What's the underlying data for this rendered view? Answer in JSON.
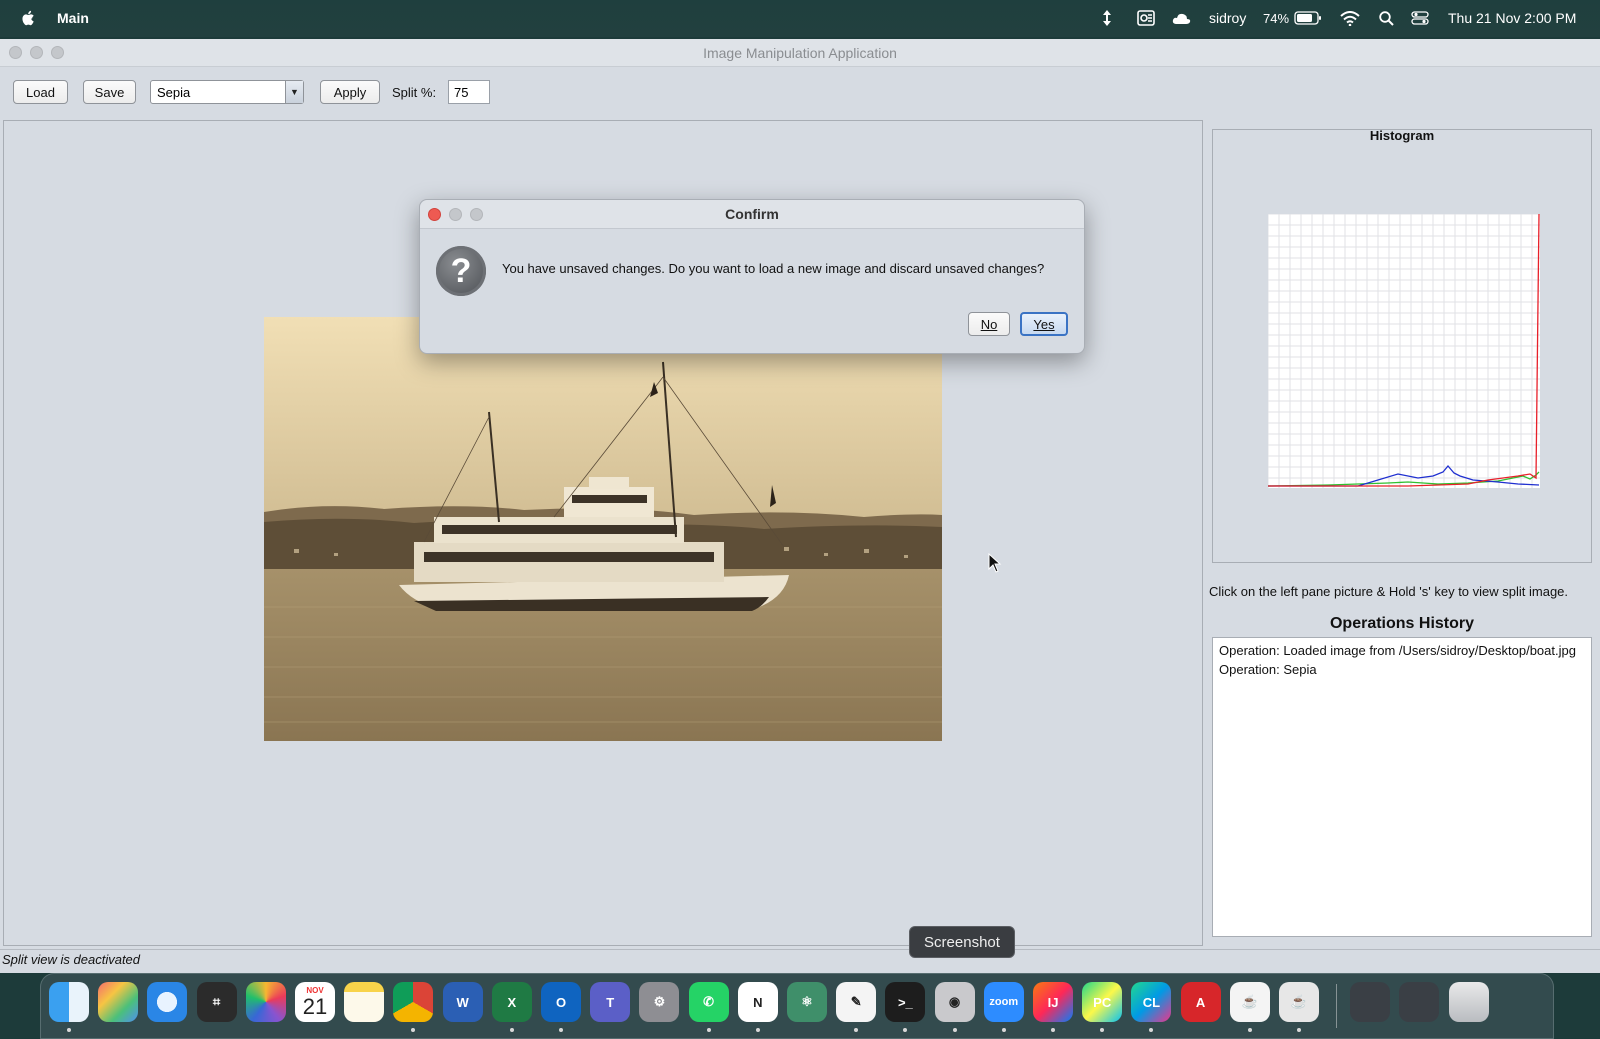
{
  "menubar": {
    "app_name": "Main",
    "user": "sidroy",
    "battery": "74%",
    "datetime": "Thu 21 Nov  2:00 PM"
  },
  "window": {
    "title": "Image Manipulation Application"
  },
  "toolbar": {
    "load_label": "Load",
    "save_label": "Save",
    "filter_selected": "Sepia",
    "apply_label": "Apply",
    "split_label": "Split %:",
    "split_value": "75"
  },
  "histogram": {
    "title": "Histogram"
  },
  "hint_text": "Click on the left pane picture & Hold 's' key to view split image.",
  "operations": {
    "title": "Operations History",
    "items": [
      "Operation: Loaded image from /Users/sidroy/Desktop/boat.jpg",
      "Operation: Sepia"
    ]
  },
  "status_text": "Split view is deactivated",
  "dialog": {
    "title": "Confirm",
    "message": "You have unsaved changes. Do you want to load a new image and discard unsaved changes?",
    "no_label": "No",
    "yes_label": "Yes"
  },
  "dock": {
    "tooltip": "Screenshot",
    "calendar_month": "NOV",
    "calendar_day": "21",
    "apps": [
      "finder-icon",
      "launchpad-icon",
      "safari-icon",
      "calculator-icon",
      "photos-icon",
      "calendar-icon",
      "notes-icon",
      "chrome-icon",
      "word-icon",
      "excel-icon",
      "outlook-icon",
      "teams-icon",
      "settings-icon",
      "whatsapp-icon",
      "notion-icon",
      "atom-icon",
      "textedit-icon",
      "terminal-icon",
      "screenshot-icon",
      "zoom-icon",
      "intellij-icon",
      "pycharm-icon",
      "clion-icon",
      "acrobat-icon",
      "java-launcher-icon",
      "java-icon",
      "downloads-stack-icon",
      "documents-stack-icon",
      "trash-icon"
    ]
  },
  "colors": {
    "accent_blue": "#3a73c4",
    "close_red": "#ee5a52",
    "histogram_red": "#e8202a",
    "histogram_green": "#30c030",
    "histogram_blue": "#1f2fd0"
  }
}
